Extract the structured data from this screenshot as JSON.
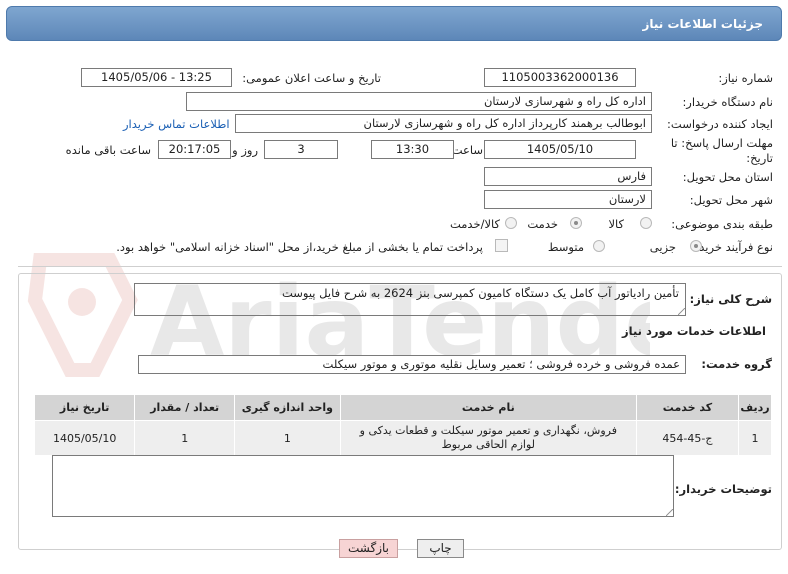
{
  "header": {
    "title": "جزئیات اطلاعات نیاز"
  },
  "form": {
    "need_number": {
      "label": "شماره نیاز:",
      "value": "1105003362000136"
    },
    "announce_datetime": {
      "label": "تاریخ و ساعت اعلان عمومی:",
      "value": "1405/05/06 - 13:25"
    },
    "buyer_org": {
      "label": "نام دستگاه خریدار:",
      "value": "اداره کل راه و شهرسازی لارستان"
    },
    "requester": {
      "label": "ایجاد کننده درخواست:",
      "value": "ابوطالب برهمند کارپرداز اداره کل راه و شهرسازی لارستان",
      "link": "اطلاعات تماس خریدار"
    },
    "deadline": {
      "label": "مهلت ارسال پاسخ: تا تاریخ:",
      "date": "1405/05/10",
      "time_label": "ساعت",
      "time": "13:30",
      "days": "3",
      "days_label": "روز و",
      "remaining": "20:17:05",
      "remaining_label": "ساعت باقی مانده"
    },
    "province": {
      "label": "استان محل تحویل:",
      "value": "فارس"
    },
    "city": {
      "label": "شهر محل تحویل:",
      "value": "لارستان"
    },
    "category": {
      "label": "طبقه بندی موضوعی:",
      "options": [
        "کالا",
        "خدمت",
        "کالا/خدمت"
      ],
      "selected": "خدمت"
    },
    "process": {
      "label": "نوع فرآیند خرید :",
      "options": [
        "جزیی",
        "متوسط"
      ],
      "selected": "جزیی",
      "payment_note": "پرداخت تمام یا بخشی از مبلغ خرید،از محل \"اسناد خزانه اسلامی\" خواهد بود."
    }
  },
  "description": {
    "label": "شرح کلی نیاز:",
    "value": "تأمین رادیاتور آب کامل یک دستگاه کامیون کمپرسی بنز 2624  به شرح فایل پیوست"
  },
  "services": {
    "title": "اطلاعات خدمات مورد نیاز",
    "group_label": "گروه خدمت:",
    "group_value": "عمده فروشی و خرده فروشی ؛ تعمیر وسایل نقلیه موتوری و موتور سیکلت",
    "columns": [
      "ردیف",
      "کد خدمت",
      "نام خدمت",
      "واحد اندازه گیری",
      "تعداد / مقدار",
      "تاریخ نیاز"
    ],
    "rows": [
      {
        "index": "1",
        "code": "ج-45-454",
        "name": "فروش، نگهداری و تعمیر موتور سیکلت و قطعات یدکی و لوازم الحاقی مربوط",
        "unit": "1",
        "qty": "1",
        "date": "1405/05/10"
      }
    ]
  },
  "buyer_notes": {
    "label": "توضیحات خریدار:",
    "value": ""
  },
  "buttons": {
    "print": "چاپ",
    "back": "بازگشت"
  },
  "colors": {
    "header": "#6b93c2",
    "back_button": "#f7d4d4",
    "print_button": "#eeeeee"
  }
}
